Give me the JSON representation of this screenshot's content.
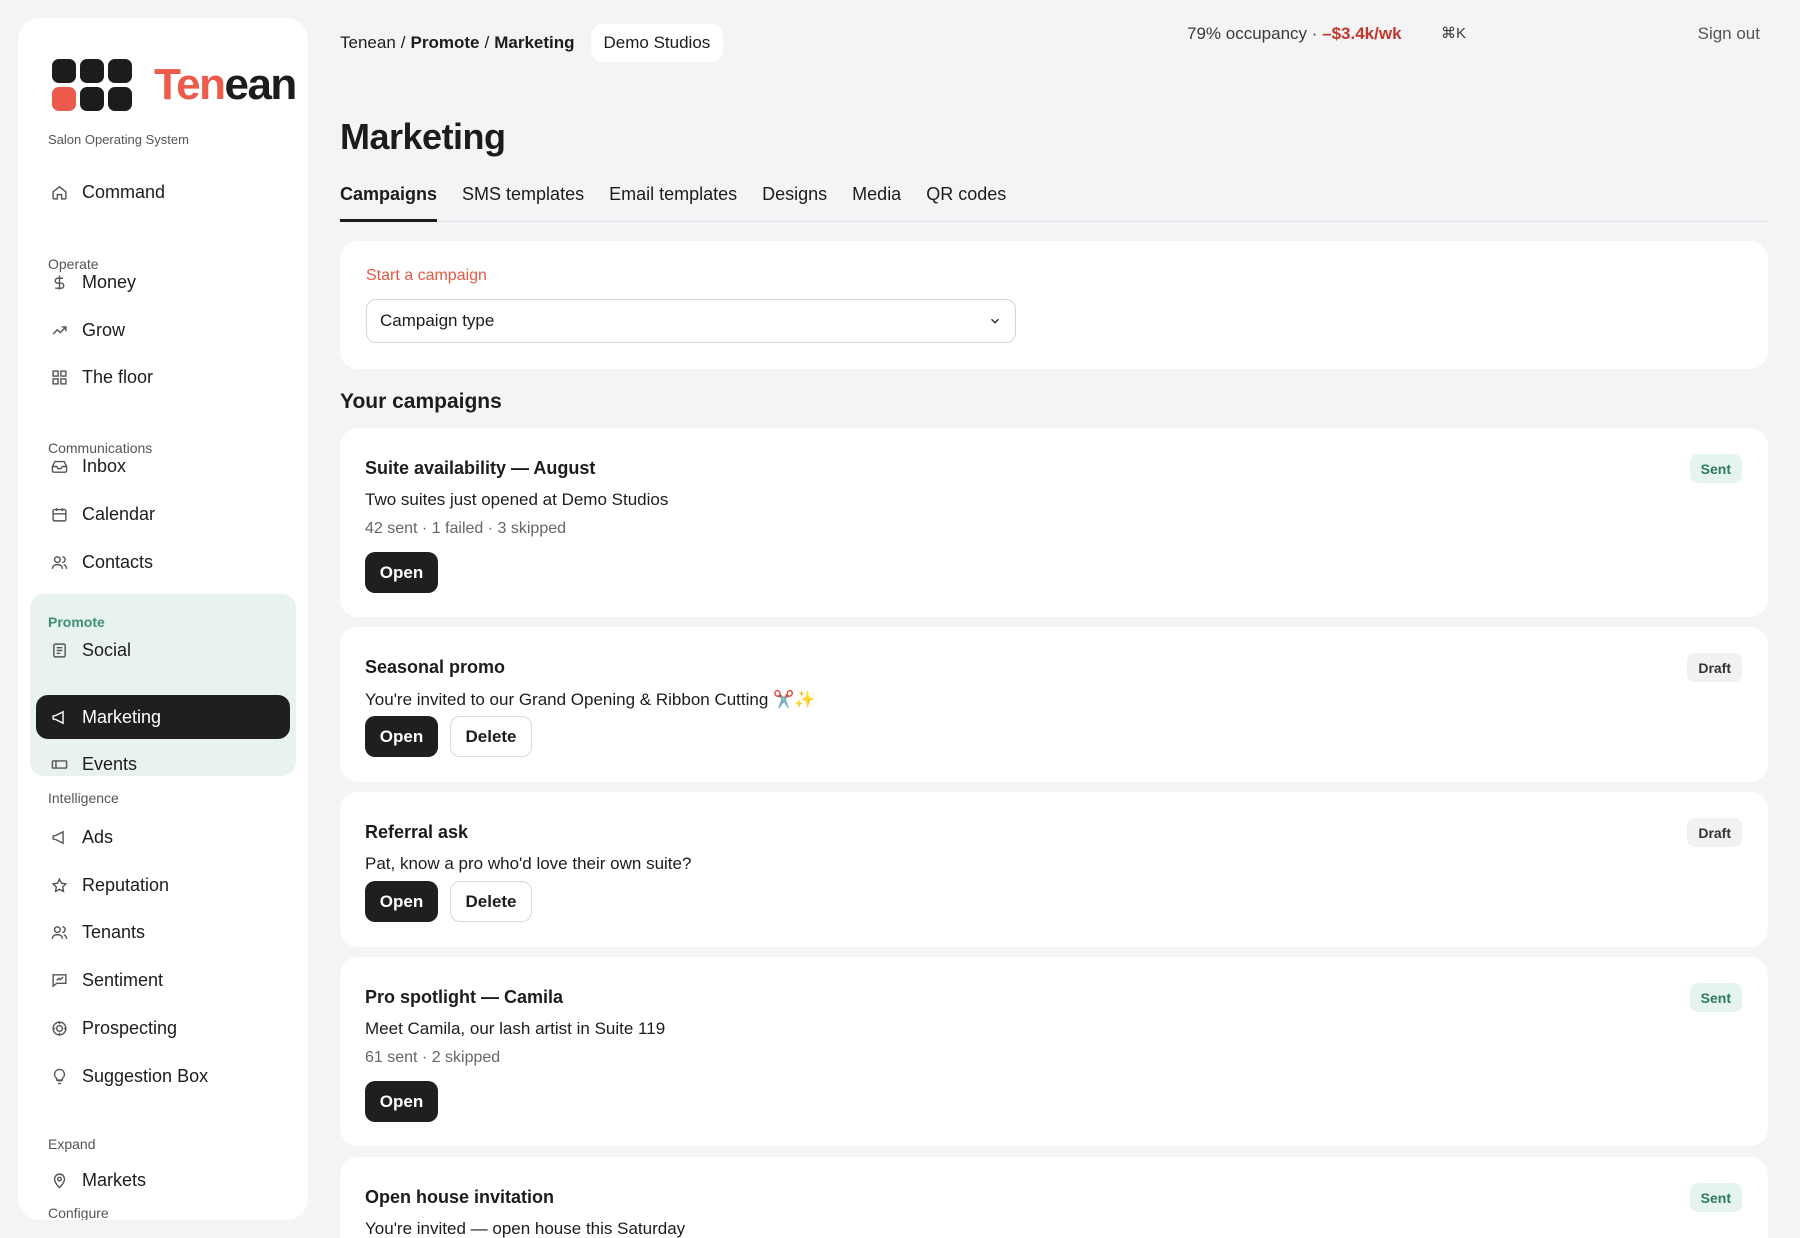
{
  "brand": {
    "name_part1": "Ten",
    "name_part2": "ean",
    "tagline": "Salon Operating System"
  },
  "sidebar": {
    "top_item": {
      "label": "Command",
      "icon": "home-icon"
    },
    "sections": [
      {
        "title": "Operate",
        "items": [
          {
            "label": "Money",
            "icon": "dollar-icon"
          },
          {
            "label": "Grow",
            "icon": "trend-up-icon"
          },
          {
            "label": "The floor",
            "icon": "grid-icon"
          }
        ]
      },
      {
        "title": "Communications",
        "items": [
          {
            "label": "Inbox",
            "icon": "inbox-icon"
          },
          {
            "label": "Calendar",
            "icon": "calendar-icon"
          },
          {
            "label": "Contacts",
            "icon": "users-icon"
          }
        ]
      },
      {
        "title": "Promote",
        "items": [
          {
            "label": "Social",
            "icon": "newspaper-icon"
          },
          {
            "label": "Marketing",
            "icon": "megaphone-icon",
            "active": true
          },
          {
            "label": "Events",
            "icon": "ticket-icon"
          }
        ]
      },
      {
        "title": "Intelligence",
        "items": [
          {
            "label": "Ads",
            "icon": "megaphone-icon"
          },
          {
            "label": "Reputation",
            "icon": "star-icon"
          },
          {
            "label": "Tenants",
            "icon": "users-icon"
          },
          {
            "label": "Sentiment",
            "icon": "chat-icon"
          },
          {
            "label": "Prospecting",
            "icon": "target-icon"
          },
          {
            "label": "Suggestion Box",
            "icon": "lightbulb-icon"
          }
        ]
      },
      {
        "title": "Expand",
        "items": [
          {
            "label": "Markets",
            "icon": "pin-icon"
          }
        ]
      },
      {
        "title": "Configure",
        "items": []
      }
    ]
  },
  "topbar": {
    "crumb_root": "Tenean",
    "crumb_section": "Promote",
    "crumb_page": "Marketing",
    "crumb_sep": "/",
    "org": "Demo Studios",
    "occupancy": "79% occupancy ·",
    "delta": "–$3.4k/wk",
    "shortcut": "⌘K",
    "signout": "Sign out"
  },
  "page": {
    "title": "Marketing",
    "tabs": [
      "Campaigns",
      "SMS templates",
      "Email templates",
      "Designs",
      "Media",
      "QR codes"
    ],
    "active_tab": "Campaigns"
  },
  "start": {
    "label": "Start a campaign",
    "select_value": "Campaign type"
  },
  "campaigns_title": "Your campaigns",
  "buttons": {
    "open": "Open",
    "delete": "Delete"
  },
  "campaigns": [
    {
      "title": "Suite availability — August",
      "subtitle": "Two suites just opened at Demo Studios",
      "meta": "42 sent · 1 failed · 3 skipped",
      "status": "Sent"
    },
    {
      "title": "Seasonal promo",
      "subtitle": "You're invited to our Grand Opening & Ribbon Cutting ✂️✨",
      "meta": "",
      "status": "Draft"
    },
    {
      "title": "Referral ask",
      "subtitle": "Pat, know a pro who'd love their own suite?",
      "meta": "",
      "status": "Draft"
    },
    {
      "title": "Pro spotlight — Camila",
      "subtitle": "Meet Camila, our lash artist in Suite 119",
      "meta": "61 sent · 2 skipped",
      "status": "Sent"
    },
    {
      "title": "Open house invitation",
      "subtitle": "You're invited — open house this Saturday",
      "meta": "",
      "status": "Sent"
    }
  ],
  "colors": {
    "accent": "#ec5b4b",
    "active_nav": "#1f1f21",
    "promote_bg": "#e8f2ef",
    "sent_badge": "#e6f4ee"
  }
}
